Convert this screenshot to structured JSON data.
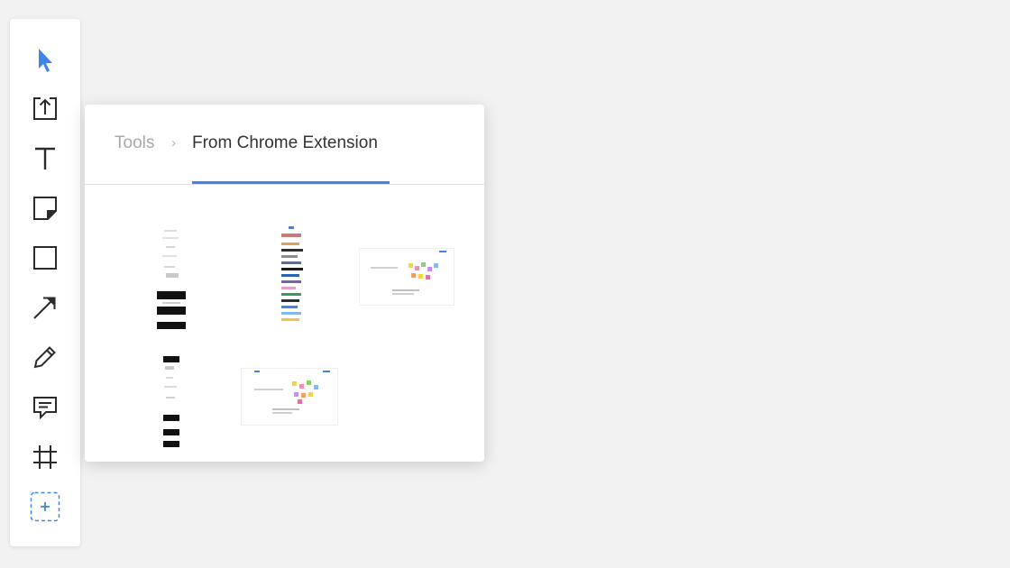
{
  "toolbar": {
    "tools": [
      {
        "name": "select-tool",
        "icon": "cursor-arrow-icon",
        "active": true
      },
      {
        "name": "upload-tool",
        "icon": "upload-icon"
      },
      {
        "name": "text-tool",
        "icon": "text-icon"
      },
      {
        "name": "sticky-note-tool",
        "icon": "sticky-note-icon"
      },
      {
        "name": "shape-tool",
        "icon": "square-icon"
      },
      {
        "name": "arrow-tool",
        "icon": "arrow-line-icon"
      },
      {
        "name": "pen-tool",
        "icon": "pencil-icon"
      },
      {
        "name": "comment-tool",
        "icon": "comment-icon"
      },
      {
        "name": "frame-tool",
        "icon": "frame-icon"
      },
      {
        "name": "more-tools",
        "icon": "add-more-icon"
      }
    ]
  },
  "panel": {
    "breadcrumb": {
      "root": "Tools",
      "separator": "›",
      "current": "From Chrome Extension"
    },
    "thumbnails": [
      {
        "name": "screenshot-thumbnail-1",
        "kind": "tall-with-dark-bars"
      },
      {
        "name": "screenshot-thumbnail-2",
        "kind": "tall-colorful-list"
      },
      {
        "name": "screenshot-thumbnail-3",
        "kind": "wide-board-with-stickies"
      },
      {
        "name": "screenshot-thumbnail-4",
        "kind": "tall-with-dark-bars"
      },
      {
        "name": "screenshot-thumbnail-5",
        "kind": "wide-board-with-stickies"
      }
    ]
  },
  "colors": {
    "accent": "#3e85e6",
    "background": "#f2f2f2",
    "icon": "#2b2b2b",
    "muted_text": "#a8a8a8"
  }
}
